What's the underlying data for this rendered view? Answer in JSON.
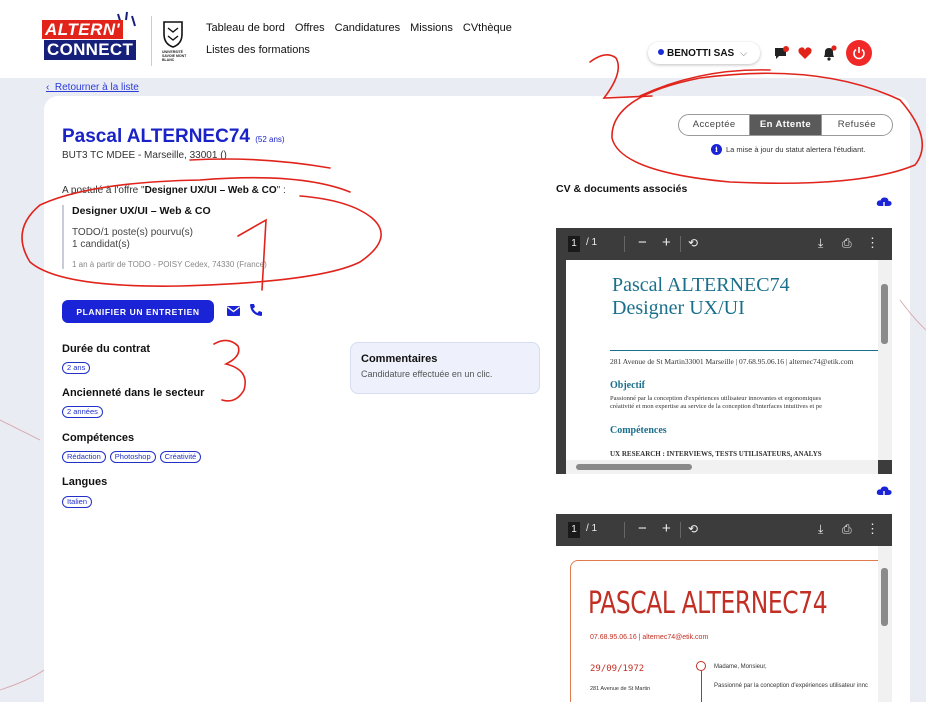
{
  "brand": {
    "logo_line1": "ALTERN'",
    "logo_line2": "CONNECT",
    "university": "UNIVERSITÉ SAVOIE MONT BLANC"
  },
  "nav": {
    "row1": [
      "Tableau de bord",
      "Offres",
      "Candidatures",
      "Missions",
      "CVthèque"
    ],
    "row2": [
      "Listes des formations"
    ]
  },
  "header": {
    "company": "BENOTTI SAS",
    "icons": [
      "chat-icon",
      "heart-icon",
      "bell-icon",
      "power-icon"
    ],
    "accent_color": "#1a23d6",
    "power_color": "#f02828"
  },
  "back_link": "Retourner à la liste",
  "candidate": {
    "name": "Pascal ALTERNEC74",
    "age": "(52 ans)",
    "school": "BUT3 TC MDEE - Marseille, 33001 ()",
    "applied_prefix": "A postulé à l'offre \"",
    "applied_offer": "Designer UX/UI – Web & CO",
    "applied_suffix": "\" :"
  },
  "offer": {
    "title": "Designer UX/UI – Web & CO",
    "positions": "TODO/1 poste(s) pourvu(s)",
    "candidates": "1 candidat(s)",
    "details": "1 an à partir de TODO - POISY Cedex, 74330 (France)"
  },
  "actions": {
    "schedule_button": "PLANIFIER UN ENTRETIEN"
  },
  "sections": {
    "duration_title": "Durée du contrat",
    "duration_tags": [
      "2 ans"
    ],
    "seniority_title": "Ancienneté dans le secteur",
    "seniority_tags": [
      "2 années"
    ],
    "skills_title": "Compétences",
    "skills_tags": [
      "Rédaction",
      "Photoshop",
      "Créativité"
    ],
    "languages_title": "Langues",
    "languages_tags": [
      "Italien"
    ]
  },
  "comments": {
    "title": "Commentaires",
    "body": "Candidature effectuée en un clic."
  },
  "status": {
    "options": [
      "Acceptée",
      "En Attente",
      "Refusée"
    ],
    "selected": "En Attente",
    "note": "La mise à jour du statut alertera l'étudiant."
  },
  "documents": {
    "title": "CV & documents associés",
    "viewer": {
      "page": "1",
      "of": "/ 1"
    },
    "cv1": {
      "name": "Pascal ALTERNEC74",
      "role": "Designer UX/UI",
      "address": "281 Avenue de St Martin33001 Marseille | 07.68.95.06.16 | alternec74@etik.com",
      "objective_title": "Objectif",
      "objective_l1": "Passionné par la conception d'expériences utilisateur innovantes et ergonomiques",
      "objective_l2": "créativité et mon expertise au service de la conception d'interfaces intuitives et pe",
      "skills_title": "Compétences",
      "skills_row": "UX RESEARCH                       : INTERVIEWS, TESTS UTILISATEURS, ANALYS"
    },
    "cv2": {
      "name": "PASCAL ALTERNEC74",
      "contact": "07.68.95.06.16 | alternec74@etik.com",
      "date": "29/09/1972",
      "address": "281 Avenue de St Martin",
      "greeting": "Madame, Monsieur,",
      "paragraph": "Passionné par la conception d'expériences utilisateur innc"
    }
  },
  "annotations": [
    "1",
    "2",
    "3"
  ]
}
